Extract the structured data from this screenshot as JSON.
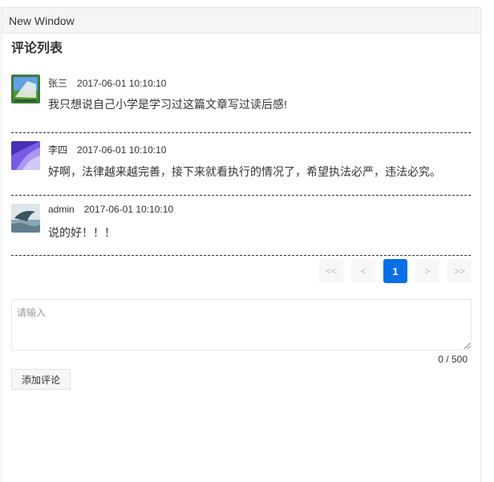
{
  "window": {
    "title": "New Window"
  },
  "list": {
    "title": "评论列表"
  },
  "comments": [
    {
      "user": "张三",
      "time": "2017-06-01 10:10:10",
      "text": "我只想说自己小学是学习过这篇文章写过读后感!"
    },
    {
      "user": "李四",
      "time": "2017-06-01 10:10:10",
      "text": "好啊，法律越来越完善，接下来就看执行的情况了，希望执法必严，违法必究。"
    },
    {
      "user": "admin",
      "time": "2017-06-01 10:10:10",
      "text": "说的好！！！"
    }
  ],
  "pager": {
    "first": "<<",
    "prev": "<",
    "current": "1",
    "next": ">",
    "last": ">>"
  },
  "editor": {
    "placeholder": "请输入",
    "counter": "0 / 500",
    "submit_label": "添加评论"
  },
  "colors": {
    "accent": "#0a6fe6",
    "divider": "#333333"
  }
}
